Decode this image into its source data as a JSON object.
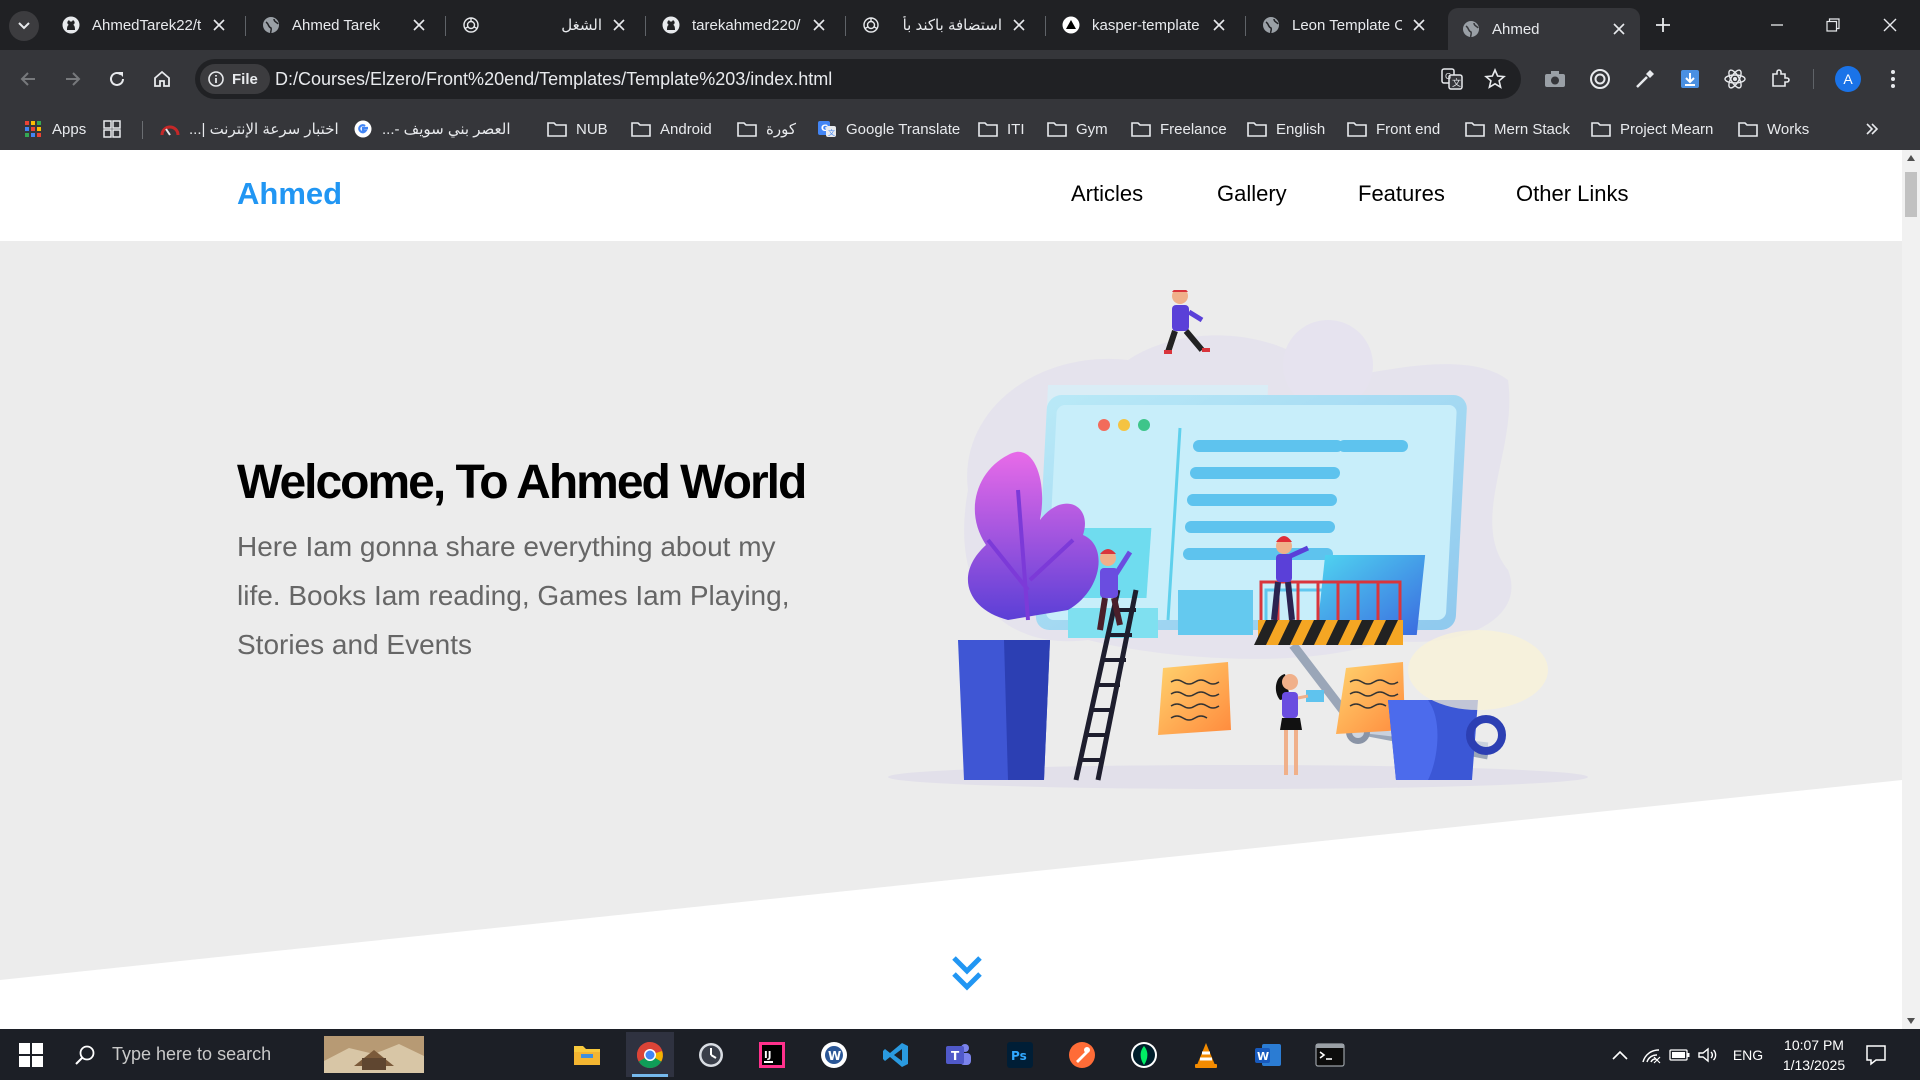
{
  "browser": {
    "tabs": [
      {
        "title": "AhmedTarek22/t",
        "favicon": "github-icon"
      },
      {
        "title": "Ahmed Tarek",
        "favicon": "globe-icon"
      },
      {
        "title": "الشغل",
        "favicon": "openai-icon"
      },
      {
        "title": "tarekahmed220/",
        "favicon": "github-icon"
      },
      {
        "title": "استضافة باكند بأ",
        "favicon": "openai-icon"
      },
      {
        "title": "kasper-template",
        "favicon": "vercel-icon"
      },
      {
        "title": "Leon Template C",
        "favicon": "globe-icon"
      },
      {
        "title": "Ahmed",
        "favicon": "globe-icon",
        "active": true
      }
    ],
    "omnibox": {
      "chip_label": "File",
      "url": "D:/Courses/Elzero/Front%20end/Templates/Template%203/index.html"
    },
    "profile_initial": "A",
    "bookmarks": [
      {
        "label": "Apps",
        "icon": "apps-grid-icon"
      },
      {
        "label": "",
        "icon": "tab-groups-icon"
      },
      {
        "label": "اختبار سرعة الإنترنت |...",
        "icon": "speedtest-icon"
      },
      {
        "label": "العصر بني سويف -...",
        "icon": "google-icon"
      },
      {
        "label": "NUB",
        "icon": "folder-icon"
      },
      {
        "label": "Android",
        "icon": "folder-icon"
      },
      {
        "label": "كورة",
        "icon": "folder-icon"
      },
      {
        "label": "Google Translate",
        "icon": "google-translate-icon"
      },
      {
        "label": "ITI",
        "icon": "folder-icon"
      },
      {
        "label": "Gym",
        "icon": "folder-icon"
      },
      {
        "label": "Freelance",
        "icon": "folder-icon"
      },
      {
        "label": "English",
        "icon": "folder-icon"
      },
      {
        "label": "Front end",
        "icon": "folder-icon"
      },
      {
        "label": "Mern Stack",
        "icon": "folder-icon"
      },
      {
        "label": "Project Mearn",
        "icon": "folder-icon"
      },
      {
        "label": "Works",
        "icon": "folder-icon"
      }
    ]
  },
  "site": {
    "logo": "Ahmed",
    "nav": [
      "Articles",
      "Gallery",
      "Features",
      "Other Links"
    ],
    "hero": {
      "title": "Welcome, To Ahmed World",
      "text": "Here Iam gonna share everything about my life. Books Iam reading, Games Iam Playing, Stories and Events"
    },
    "colors": {
      "accent": "#2196f3",
      "hero_bg": "#ececec"
    }
  },
  "taskbar": {
    "search_placeholder": "Type here to search",
    "apps": [
      "file-explorer-icon",
      "chrome-icon",
      "clock-app-icon",
      "intellij-icon",
      "word-online-icon",
      "vscode-icon",
      "teams-icon",
      "photoshop-icon",
      "postman-icon",
      "mongodb-compass-icon",
      "vlc-icon",
      "word-icon",
      "terminal-icon"
    ],
    "language": "ENG",
    "time": "10:07 PM",
    "date": "1/13/2025"
  }
}
